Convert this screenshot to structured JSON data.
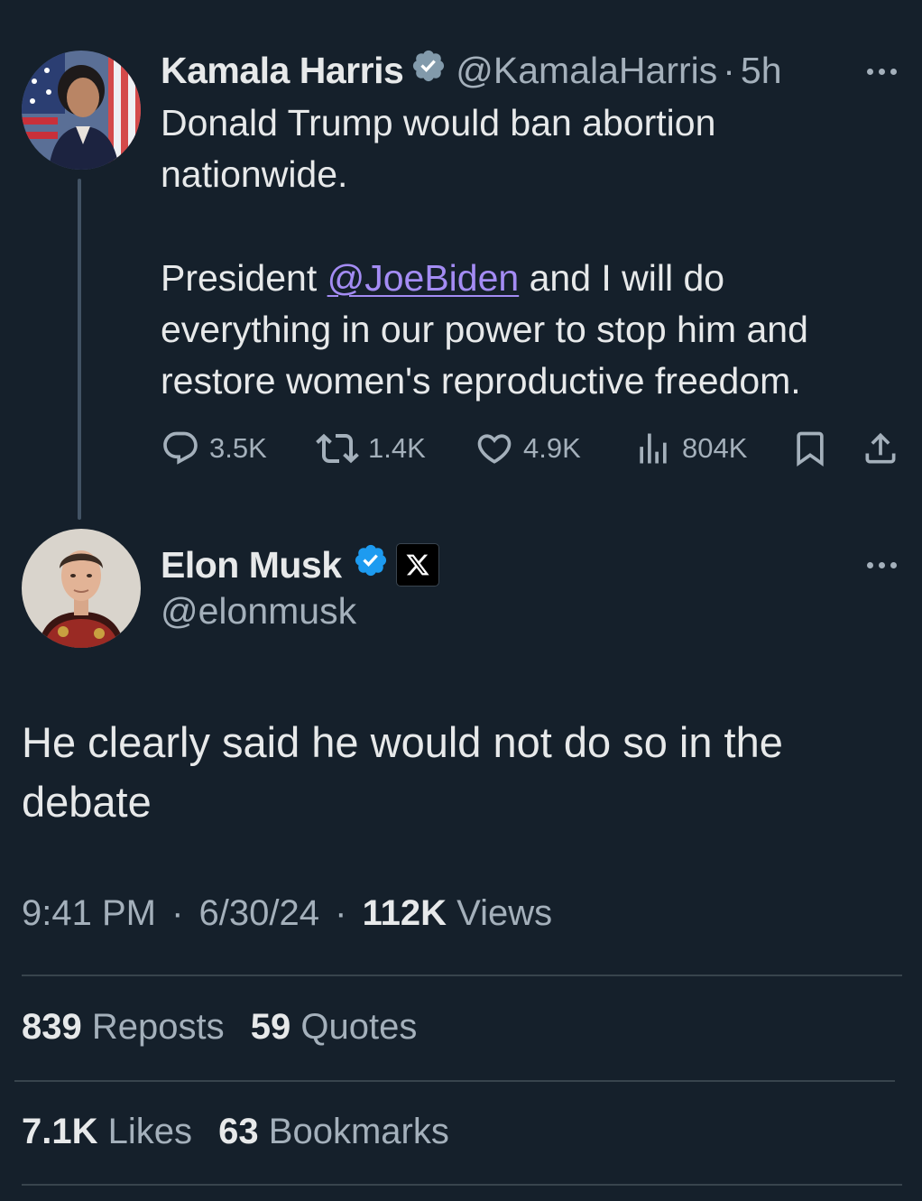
{
  "parent_tweet": {
    "display_name": "Kamala Harris",
    "handle": "@KamalaHarris",
    "separator": "·",
    "time_ago": "5h",
    "text_line1": "Donald Trump would ban abortion",
    "text_line2": "nationwide.",
    "text_p2_prefix": "President ",
    "mention": "@JoeBiden",
    "text_p2_suffix": " and I will do",
    "text_line4": "everything in our power to stop him and",
    "text_line5": "restore women's reproductive freedom.",
    "counts": {
      "replies": "3.5K",
      "reposts": "1.4K",
      "likes": "4.9K",
      "views": "804K"
    },
    "icons": [
      "verified-badge-icon",
      "more-icon",
      "reply-icon",
      "repost-icon",
      "like-icon",
      "views-icon",
      "bookmark-icon",
      "share-icon"
    ]
  },
  "reply_tweet": {
    "display_name": "Elon Musk",
    "handle": "@elonmusk",
    "text": "He clearly said he would not do so in the debate",
    "time": "9:41 PM",
    "separator": "·",
    "date": "6/30/24",
    "views_count": "112K",
    "views_label": "Views",
    "reposts_count": "839",
    "reposts_label": "Reposts",
    "quotes_count": "59",
    "quotes_label": "Quotes",
    "likes_count": "7.1K",
    "likes_label": "Likes",
    "bookmarks_count": "63",
    "bookmarks_label": "Bookmarks",
    "icons": [
      "verified-badge-icon",
      "x-logo-icon",
      "more-icon"
    ]
  },
  "colors": {
    "background": "#15202b",
    "text_primary": "#e7e9ea",
    "text_secondary": "#a4b0bb",
    "verified_gray": "#829aab",
    "verified_blue": "#1d9bf0",
    "mention": "#a48cf4",
    "divider": "#38444d"
  }
}
